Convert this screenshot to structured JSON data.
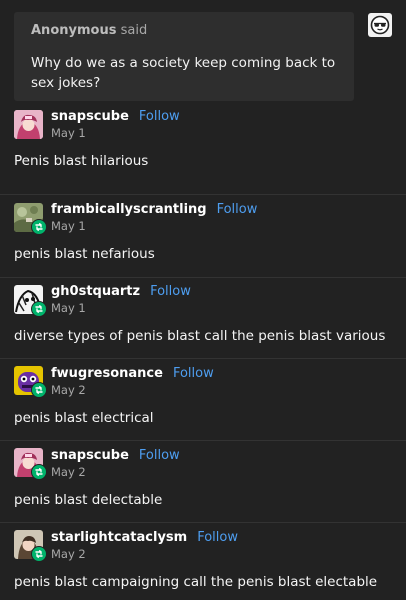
{
  "ask": {
    "asker": "Anonymous",
    "said": "said",
    "question_line1": "Why do we as a society keep coming back to",
    "question_line2": "sex jokes?"
  },
  "posts": [
    {
      "user": "snapscube",
      "follow": "Follow",
      "date": "May 1",
      "text": "Penis blast hilarious",
      "reblog": false
    },
    {
      "user": "frambicallyscrantling",
      "follow": "Follow",
      "date": "May 1",
      "text": "penis blast nefarious",
      "reblog": true
    },
    {
      "user": "gh0stquartz",
      "follow": "Follow",
      "date": "May 1",
      "text": "diverse types of penis blast call the penis blast various",
      "reblog": true
    },
    {
      "user": "fwugresonance",
      "follow": "Follow",
      "date": "May 2",
      "text": "penis blast electrical",
      "reblog": true
    },
    {
      "user": "snapscube",
      "follow": "Follow",
      "date": "May 2",
      "text": "penis blast delectable",
      "reblog": true
    },
    {
      "user": "starlightcataclysm",
      "follow": "Follow",
      "date": "May 2",
      "text": "penis blast campaigning call the penis blast electable",
      "reblog": true
    }
  ],
  "colors": {
    "background": "#222222",
    "follow": "#4e9ef0",
    "reblog": "#00b36b"
  },
  "icons": {
    "reblog": "reblog-icon",
    "anon": "anonymous-sunglasses-icon"
  }
}
